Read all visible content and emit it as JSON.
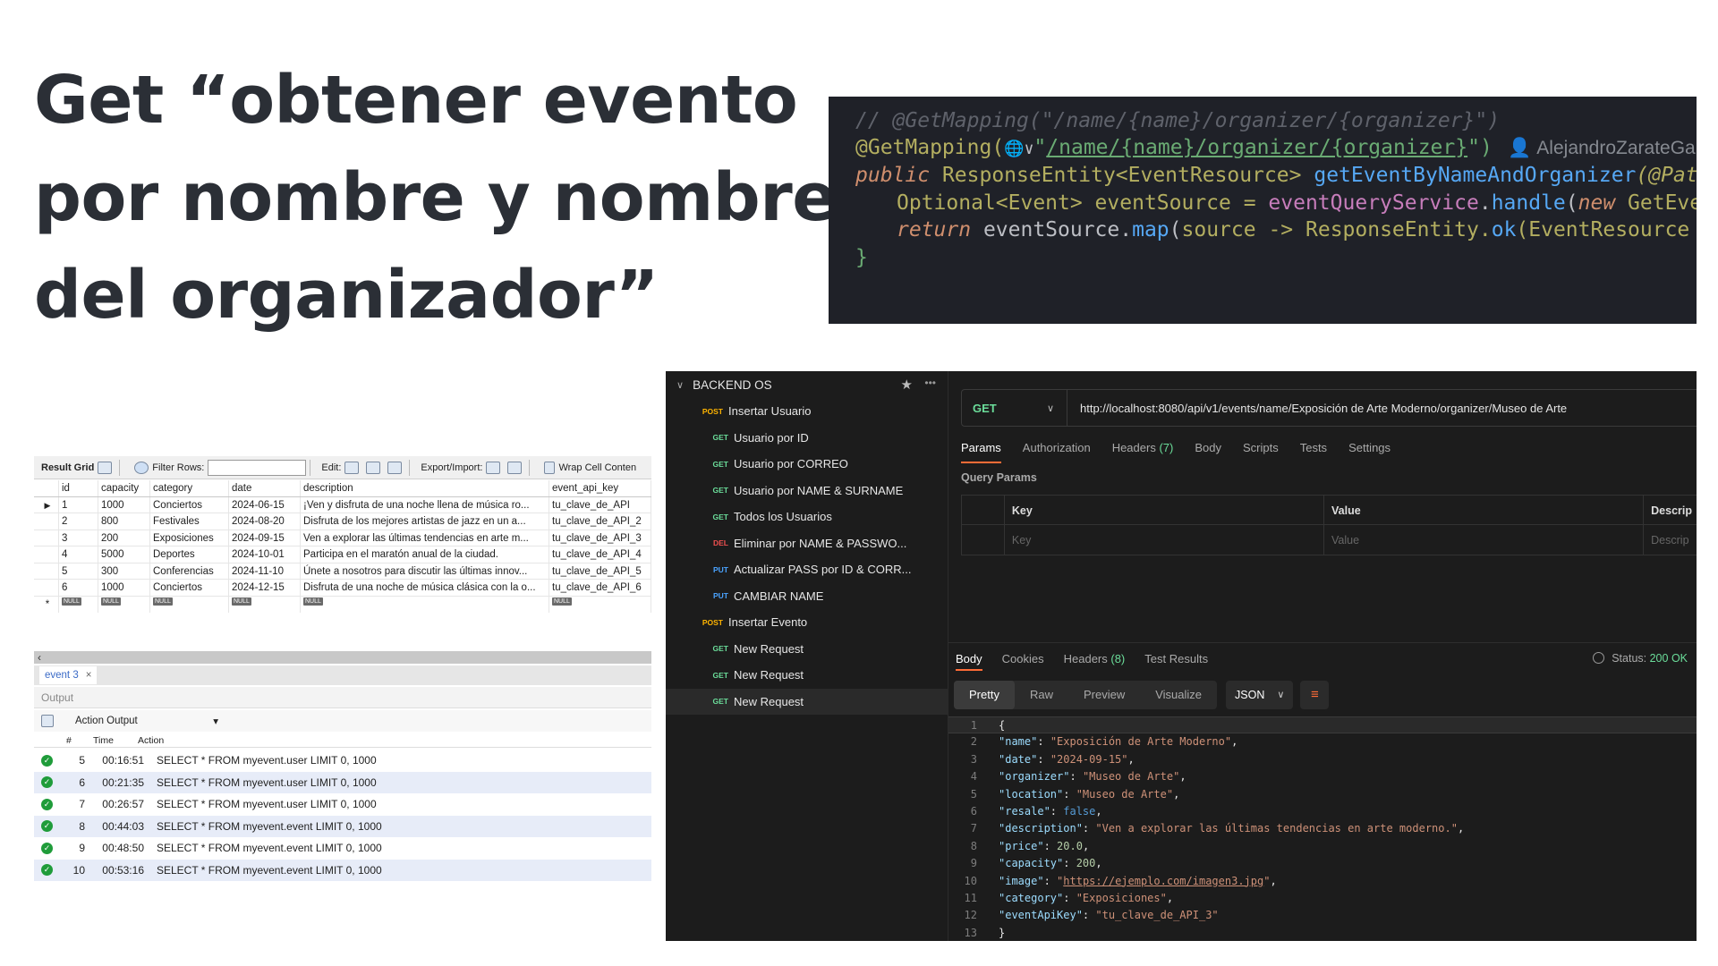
{
  "slide": {
    "title_lines": [
      "Get “obtener evento",
      "por nombre y nombre",
      "del organizador”"
    ]
  },
  "code": {
    "line1": "// @GetMapping(\"/name/{name}/organizer/{organizer}\")",
    "line2_ann": "@GetMapping(",
    "line2_globe": "🌐∨",
    "line2_q1": "\"",
    "line2_path": "/name/{name}/organizer/{organizer}",
    "line2_q2": "\")",
    "line2_author": "AlejandroZarateGa",
    "line3_kw": "public ",
    "line3_type": "ResponseEntity<EventResource> ",
    "line3_fn": "getEventByNameAndOrganizer",
    "line3_rest": "(@Pat",
    "line4_a": "Optional<Event> eventSource = ",
    "line4_svc": "eventQueryService",
    "line4_b": ".",
    "line4_fn": "handle",
    "line4_c": "(",
    "line4_kw": "new ",
    "line4_d": "GetEve",
    "line5_kw": "return ",
    "line5_a": "eventSource.",
    "line5_fn": "map",
    "line5_b": "(",
    "line5_src": "source",
    "line5_c": " -> ResponseEntity.",
    "line5_ok": "ok",
    "line5_d": "(EventResource",
    "line6": "}"
  },
  "workbench": {
    "toolbar": {
      "result_grid": "Result Grid",
      "filter_rows": "Filter Rows:",
      "edit": "Edit:",
      "export_import": "Export/Import:",
      "wrap": "Wrap Cell Conten"
    },
    "columns": [
      "id",
      "capacity",
      "category",
      "date",
      "description",
      "event_api_key"
    ],
    "rows": [
      [
        "1",
        "1000",
        "Conciertos",
        "2024-06-15",
        "¡Ven y disfruta de una noche llena de música ro...",
        "tu_clave_de_API"
      ],
      [
        "2",
        "800",
        "Festivales",
        "2024-08-20",
        "Disfruta de los mejores artistas de jazz en un a...",
        "tu_clave_de_API_2"
      ],
      [
        "3",
        "200",
        "Exposiciones",
        "2024-09-15",
        "Ven a explorar las últimas tendencias en arte m...",
        "tu_clave_de_API_3"
      ],
      [
        "4",
        "5000",
        "Deportes",
        "2024-10-01",
        "Participa en el maratón anual de la ciudad.",
        "tu_clave_de_API_4"
      ],
      [
        "5",
        "300",
        "Conferencias",
        "2024-11-10",
        "Únete a nosotros para discutir las últimas innov...",
        "tu_clave_de_API_5"
      ],
      [
        "6",
        "1000",
        "Conciertos",
        "2024-12-15",
        "Disfruta de una noche de música clásica con la o...",
        "tu_clave_de_API_6"
      ]
    ],
    "null_badge": "NULL",
    "tab": "event 3",
    "output_label": "Output",
    "output_select": "Action Output",
    "output_cols": [
      "#",
      "Time",
      "Action"
    ],
    "output_rows": [
      [
        "5",
        "00:16:51",
        "SELECT * FROM myevent.user LIMIT 0, 1000"
      ],
      [
        "6",
        "00:21:35",
        "SELECT * FROM myevent.user LIMIT 0, 1000"
      ],
      [
        "7",
        "00:26:57",
        "SELECT * FROM myevent.user LIMIT 0, 1000"
      ],
      [
        "8",
        "00:44:03",
        "SELECT * FROM myevent.event LIMIT 0, 1000"
      ],
      [
        "9",
        "00:48:50",
        "SELECT * FROM myevent.event LIMIT 0, 1000"
      ],
      [
        "10",
        "00:53:16",
        "SELECT * FROM myevent.event LIMIT 0, 1000"
      ]
    ]
  },
  "postman": {
    "collection": "BACKEND OS",
    "items": [
      {
        "method": "POST",
        "name": "Insertar Usuario"
      },
      {
        "method": "GET",
        "name": "Usuario por ID"
      },
      {
        "method": "GET",
        "name": "Usuario por CORREO"
      },
      {
        "method": "GET",
        "name": "Usuario por NAME & SURNAME"
      },
      {
        "method": "GET",
        "name": "Todos los Usuarios"
      },
      {
        "method": "DEL",
        "name": "Eliminar por NAME & PASSWO..."
      },
      {
        "method": "PUT",
        "name": "Actualizar PASS por ID & CORR..."
      },
      {
        "method": "PUT",
        "name": "CAMBIAR NAME"
      },
      {
        "method": "POST",
        "name": "Insertar Evento"
      },
      {
        "method": "GET",
        "name": "New Request"
      },
      {
        "method": "GET",
        "name": "New Request"
      },
      {
        "method": "GET",
        "name": "New Request"
      }
    ],
    "request": {
      "method": "GET",
      "url": "http://localhost:8080/api/v1/events/name/Exposición de Arte Moderno/organizer/Museo de Arte"
    },
    "req_tabs": {
      "params": "Params",
      "authorization": "Authorization",
      "headers": "Headers",
      "headers_count": "(7)",
      "body": "Body",
      "scripts": "Scripts",
      "tests": "Tests",
      "settings": "Settings"
    },
    "query_params_label": "Query Params",
    "qp_head": {
      "key": "Key",
      "value": "Value",
      "desc": "Descrip"
    },
    "qp_placeholder": {
      "key": "Key",
      "value": "Value",
      "desc": "Descrip"
    },
    "resp_tabs": {
      "body": "Body",
      "cookies": "Cookies",
      "headers": "Headers",
      "headers_count": "(8)",
      "test_results": "Test Results"
    },
    "status_label": "Status:",
    "status_value": "200 OK",
    "format_tabs": [
      "Pretty",
      "Raw",
      "Preview",
      "Visualize"
    ],
    "format": "JSON",
    "json_lines": [
      {
        "n": "1",
        "t": "{"
      },
      {
        "n": "2",
        "k": "\"name\"",
        "v": "\"Exposición de Arte Moderno\"",
        "vt": "s"
      },
      {
        "n": "3",
        "k": "\"date\"",
        "v": "\"2024-09-15\"",
        "vt": "s"
      },
      {
        "n": "4",
        "k": "\"organizer\"",
        "v": "\"Museo de Arte\"",
        "vt": "s"
      },
      {
        "n": "5",
        "k": "\"location\"",
        "v": "\"Museo de Arte\"",
        "vt": "s"
      },
      {
        "n": "6",
        "k": "\"resale\"",
        "v": "false",
        "vt": "b"
      },
      {
        "n": "7",
        "k": "\"description\"",
        "v": "\"Ven a explorar las últimas tendencias en arte moderno.\"",
        "vt": "s"
      },
      {
        "n": "8",
        "k": "\"price\"",
        "v": "20.0",
        "vt": "num"
      },
      {
        "n": "9",
        "k": "\"capacity\"",
        "v": "200",
        "vt": "num"
      },
      {
        "n": "10",
        "k": "\"image\"",
        "v": "https://ejemplo.com/imagen3.jpg",
        "vt": "link"
      },
      {
        "n": "11",
        "k": "\"category\"",
        "v": "\"Exposiciones\"",
        "vt": "s"
      },
      {
        "n": "12",
        "k": "\"eventApiKey\"",
        "v": "\"tu_clave_de_API_3\"",
        "vt": "s",
        "last": true
      },
      {
        "n": "13",
        "t": "}"
      }
    ]
  }
}
